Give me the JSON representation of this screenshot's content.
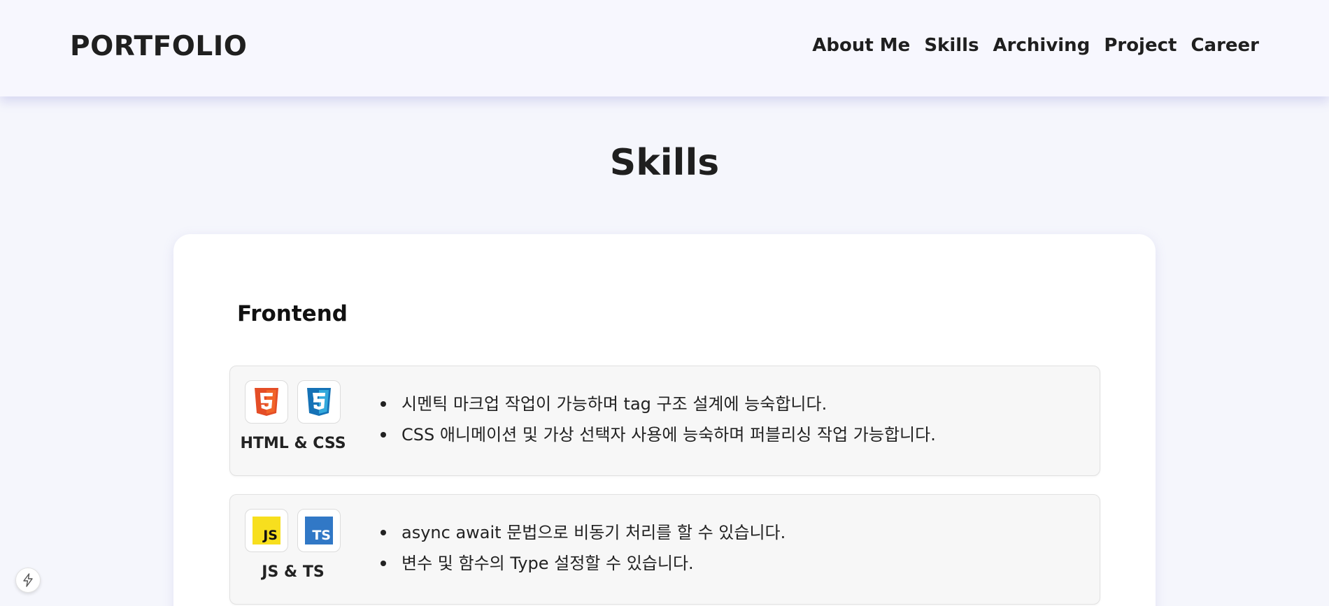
{
  "header": {
    "logo": "PORTFOLIO",
    "nav": [
      "About Me",
      "Skills",
      "Archiving",
      "Project",
      "Career"
    ]
  },
  "section": {
    "title": "Skills"
  },
  "skills": {
    "category": "Frontend",
    "rows": [
      {
        "name": "HTML & CSS",
        "icons": [
          "html5-icon",
          "css3-icon"
        ],
        "desc": [
          "시멘틱 마크업 작업이 가능하며 tag 구조 설계에 능숙합니다.",
          "CSS 애니메이션 및 가상 선택자 사용에 능숙하며 퍼블리싱 작업 가능합니다."
        ]
      },
      {
        "name": "JS & TS",
        "icons": [
          "javascript-icon",
          "typescript-icon"
        ],
        "badges": {
          "js": "JS",
          "ts": "TS"
        },
        "desc": [
          "async await 문법으로 비동기 처리를 할 수 있습니다.",
          "변수 및 함수의 Type 설정할 수 있습니다."
        ]
      }
    ]
  },
  "colors": {
    "background": "#f5f6fc",
    "html5": "#e44d26",
    "css3": "#1572b6",
    "js": "#f7df1e",
    "ts": "#3178c6"
  },
  "floating_button_icon": "lightning-icon"
}
